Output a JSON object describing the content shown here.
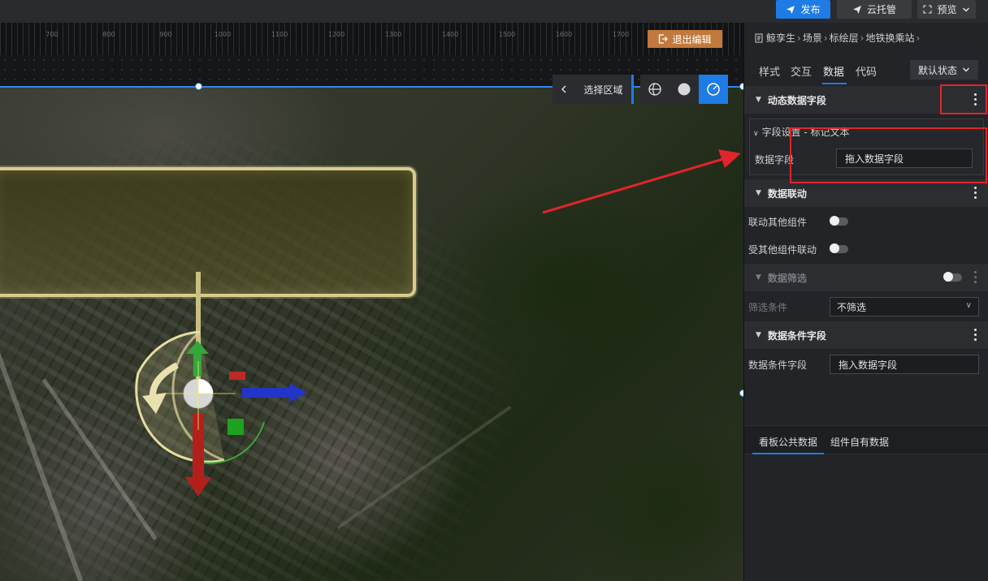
{
  "topbar": {
    "publish_label": "发布",
    "hosting_label": "云托管",
    "preview_label": "预览"
  },
  "canvas": {
    "ruler_ticks": [
      "700",
      "800",
      "900",
      "1000",
      "1100",
      "1200",
      "1300",
      "1400",
      "1500",
      "1600",
      "1700",
      "1800"
    ],
    "exit_edit_label": "退出编辑",
    "region_label": "选择区域"
  },
  "panel": {
    "breadcrumb": [
      "鲸孪生",
      "场景",
      "标绘层",
      "地铁换乘站"
    ],
    "tabs": [
      "样式",
      "交互",
      "数据",
      "代码"
    ],
    "active_tab": "数据",
    "state_select": "默认状态",
    "dynamic_section": {
      "title": "动态数据字段",
      "sub_title": "字段设置 - 标记文本",
      "field_label": "数据字段",
      "field_placeholder": "拖入数据字段"
    },
    "linkage_section": {
      "title": "数据联动",
      "link_other_label": "联动其他组件",
      "linked_by_other_label": "受其他组件联动",
      "link_other_on": false,
      "linked_by_other_on": false
    },
    "filter_section": {
      "title": "数据筛选",
      "enabled": false,
      "condition_label": "筛选条件",
      "condition_value": "不筛选"
    },
    "condition_section": {
      "title": "数据条件字段",
      "field_label": "数据条件字段",
      "field_placeholder": "拖入数据字段"
    },
    "bottom_tabs": [
      "看板公共数据",
      "组件自有数据"
    ],
    "active_bottom_tab": "看板公共数据"
  },
  "colors": {
    "accent": "#1f7be6",
    "exit_button": "#c17a3c",
    "annotation_red": "#e0242b",
    "label_border": "#d9cc8b"
  }
}
